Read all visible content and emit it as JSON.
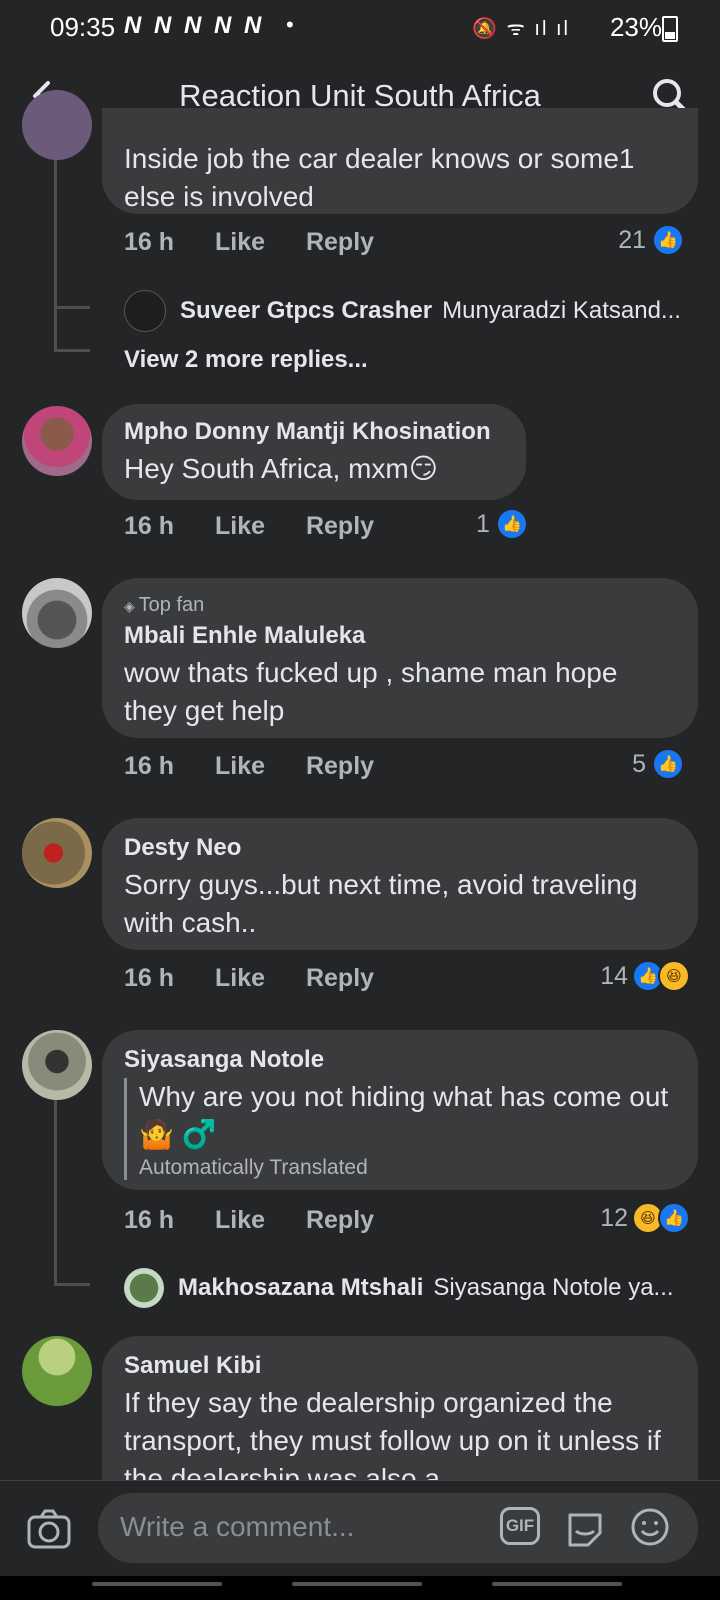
{
  "status_bar": {
    "time": "09:35",
    "notifications": "N N N N N",
    "dot": "•",
    "battery": "23%"
  },
  "header": {
    "title": "Reaction Unit South Africa"
  },
  "comments": [
    {
      "text": "Inside job the car dealer knows or some1 else is involved",
      "time": "16 h",
      "like": "Like",
      "reply": "Reply",
      "reactions": "21",
      "replies": [
        {
          "name": "Suveer Gtpcs Crasher",
          "text": "Munyaradzi Katsand..."
        }
      ],
      "view_more": "View 2 more replies..."
    },
    {
      "name": "Mpho Donny Mantji Khosination",
      "text": "Hey South Africa, mxm😏",
      "time": "16 h",
      "like": "Like",
      "reply": "Reply",
      "reactions": "1"
    },
    {
      "badge": "Top fan",
      "name": "Mbali Enhle Maluleka",
      "text": "wow thats fucked up , shame man hope they get help",
      "time": "16 h",
      "like": "Like",
      "reply": "Reply",
      "reactions": "5"
    },
    {
      "name": "Desty Neo",
      "text": "Sorry guys...but next time, avoid traveling with cash..",
      "time": "16 h",
      "like": "Like",
      "reply": "Reply",
      "reactions": "14"
    },
    {
      "name": "Siyasanga Notole",
      "text": "Why are you not hiding what has come out 🤷 ♂️",
      "translated": "Automatically Translated",
      "time": "16 h",
      "like": "Like",
      "reply": "Reply",
      "reactions": "12",
      "replies": [
        {
          "name": "Makhosazana Mtshali",
          "text": "Siyasanga Notole ya..."
        }
      ]
    },
    {
      "name": "Samuel Kibi",
      "text": "If they say the dealership organized the transport, they must follow up on it unless if the dealership was also a"
    }
  ],
  "composer": {
    "placeholder": "Write a comment..."
  },
  "colors": {
    "background": "#242526",
    "bubble": "#3a3b3c",
    "like_blue": "#1877f2",
    "haha_yellow": "#f7b928"
  }
}
